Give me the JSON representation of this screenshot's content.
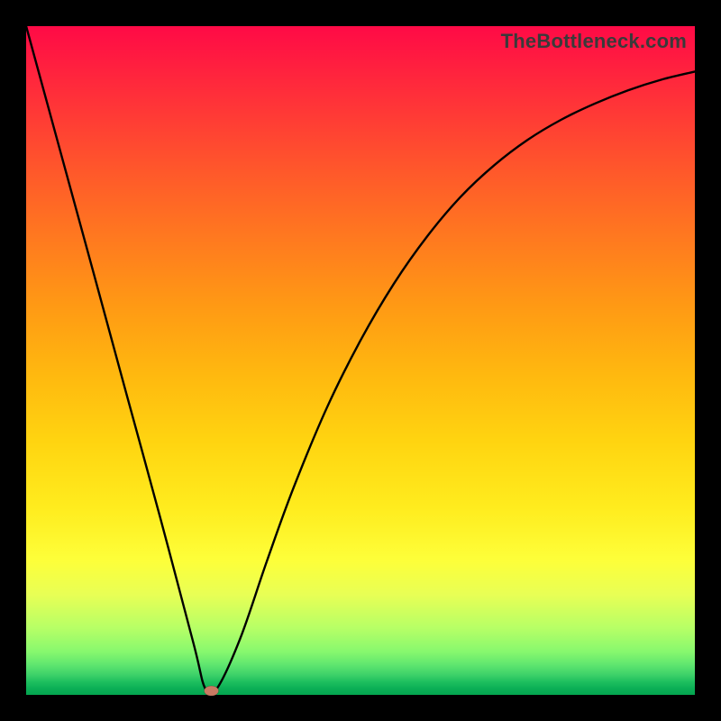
{
  "watermark": "TheBottleneck.com",
  "chart_data": {
    "type": "line",
    "title": "",
    "xlabel": "",
    "ylabel": "",
    "xlim": [
      0,
      1
    ],
    "ylim": [
      0,
      1
    ],
    "grid": false,
    "legend": false,
    "notes": "V-shaped bottleneck curve on rainbow gradient background; minimum marked with a small dot near the bottom.",
    "series": [
      {
        "name": "bottleneck-curve",
        "x": [
          0.0,
          0.05,
          0.1,
          0.15,
          0.2,
          0.25,
          0.268,
          0.285,
          0.32,
          0.36,
          0.4,
          0.45,
          0.5,
          0.55,
          0.6,
          0.65,
          0.7,
          0.75,
          0.8,
          0.85,
          0.9,
          0.95,
          1.0
        ],
        "y": [
          1.0,
          0.817,
          0.634,
          0.45,
          0.267,
          0.078,
          0.009,
          0.009,
          0.084,
          0.2,
          0.31,
          0.43,
          0.53,
          0.615,
          0.686,
          0.745,
          0.792,
          0.83,
          0.86,
          0.884,
          0.904,
          0.92,
          0.932
        ]
      }
    ],
    "annotations": [
      {
        "name": "min-point",
        "x": 0.277,
        "y": 0.006
      }
    ],
    "background_gradient_stops": [
      {
        "pos": 0.0,
        "color": "#ff0a46"
      },
      {
        "pos": 0.5,
        "color": "#ffb80f"
      },
      {
        "pos": 0.8,
        "color": "#fdff3a"
      },
      {
        "pos": 1.0,
        "color": "#04a550"
      }
    ]
  }
}
